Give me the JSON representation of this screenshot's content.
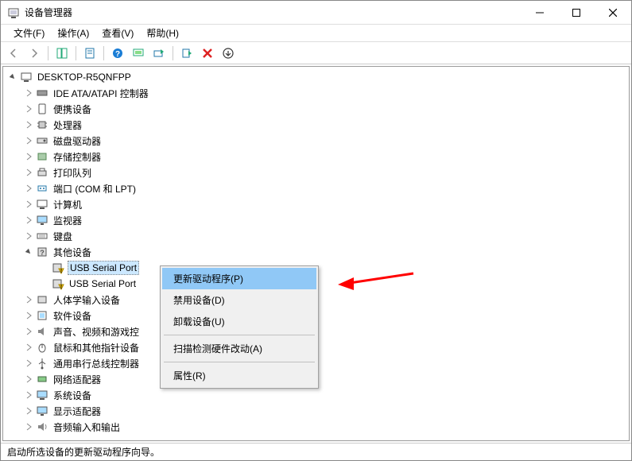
{
  "window": {
    "title": "设备管理器"
  },
  "menu": {
    "file": "文件(F)",
    "action": "操作(A)",
    "view": "查看(V)",
    "help": "帮助(H)"
  },
  "tree": {
    "root": "DESKTOP-R5QNFPP",
    "cat0": "IDE ATA/ATAPI 控制器",
    "cat1": "便携设备",
    "cat2": "处理器",
    "cat3": "磁盘驱动器",
    "cat4": "存储控制器",
    "cat5": "打印队列",
    "cat6": "端口 (COM 和 LPT)",
    "cat7": "计算机",
    "cat8": "监视器",
    "cat9": "键盘",
    "cat10": "其他设备",
    "cat10_child0": "USB Serial Port",
    "cat10_child1": "USB Serial Port",
    "cat11": "人体学输入设备",
    "cat12": "软件设备",
    "cat13": "声音、视频和游戏控",
    "cat14": "鼠标和其他指针设备",
    "cat15": "通用串行总线控制器",
    "cat16": "网络适配器",
    "cat17": "系统设备",
    "cat18": "显示适配器",
    "cat19": "音频输入和输出"
  },
  "context_menu": {
    "update_driver": "更新驱动程序(P)",
    "disable": "禁用设备(D)",
    "uninstall": "卸载设备(U)",
    "scan_hw": "扫描检测硬件改动(A)",
    "properties": "属性(R)"
  },
  "statusbar": {
    "text": "启动所选设备的更新驱动程序向导。"
  }
}
